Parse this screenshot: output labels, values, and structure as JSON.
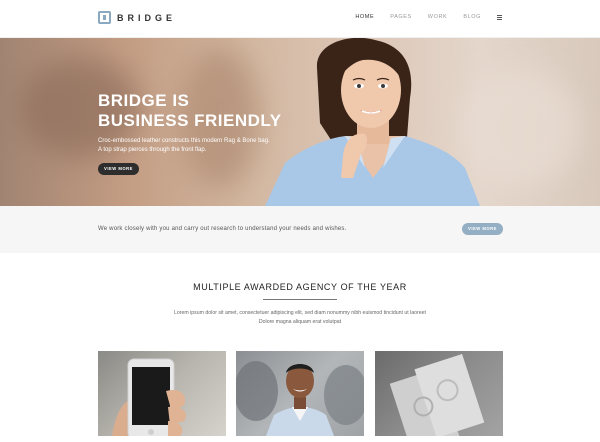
{
  "header": {
    "logo_text": "BRIDGE",
    "nav": [
      {
        "label": "HOME",
        "active": true
      },
      {
        "label": "PAGES",
        "active": false
      },
      {
        "label": "WORK",
        "active": false
      },
      {
        "label": "BLOG",
        "active": false
      }
    ]
  },
  "hero": {
    "title_line1": "BRIDGE IS",
    "title_line2": "BUSINESS FRIENDLY",
    "text_line1": "Croc-embossed leather constructs this modern Rag & Bone bag.",
    "text_line2": "A top strap pierces through the front flap.",
    "button_label": "VIEW MORE"
  },
  "strip": {
    "text": "We work closely with you and carry out research to understand your needs and wishes.",
    "button_label": "VIEW MORE"
  },
  "section": {
    "title": "MULTIPLE AWARDED AGENCY OF THE YEAR",
    "text_line1": "Lorem ipsum dolor sit amet, consectetuer adipiscing elit, sed diam nonummy nibh euismod tincidunt ut laoreet",
    "text_line2": "Dolore magna aliquam erat volutpat"
  },
  "colors": {
    "accent": "#94aec3",
    "dark_button": "#2d2d2d"
  }
}
